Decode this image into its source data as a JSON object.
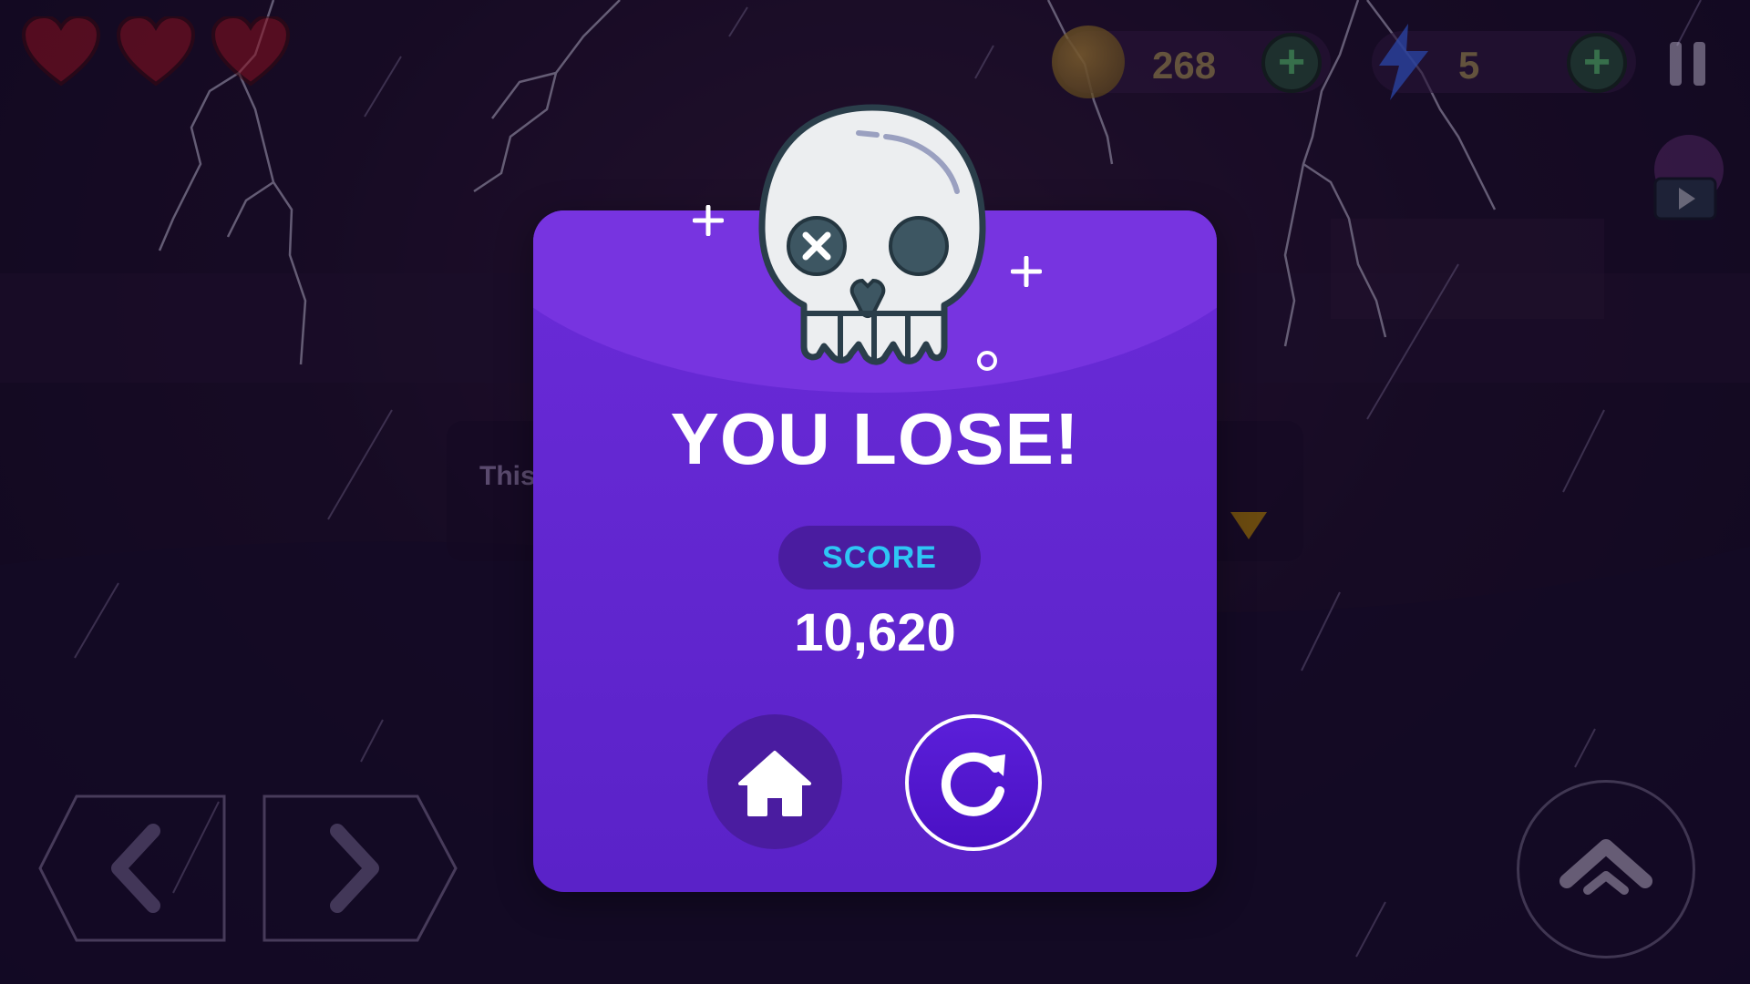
{
  "hud": {
    "hearts": [
      {
        "state": "full"
      },
      {
        "state": "full"
      },
      {
        "state": "full"
      }
    ],
    "coins": "268",
    "energy": "5",
    "icons": {
      "coin": "coin-icon",
      "energy": "lightning-icon",
      "pause": "pause-icon",
      "video": "video-reward-icon"
    }
  },
  "hint": {
    "text": "This"
  },
  "popup": {
    "title": "YOU LOSE!",
    "score_label": "SCORE",
    "score_value": "10,620",
    "buttons": {
      "home": "home-icon",
      "retry": "replay-icon"
    }
  },
  "colors": {
    "popup_bg": "#5a22c8",
    "score_label": "#2ec6f5",
    "pill_bg": "#4a1ca0"
  }
}
